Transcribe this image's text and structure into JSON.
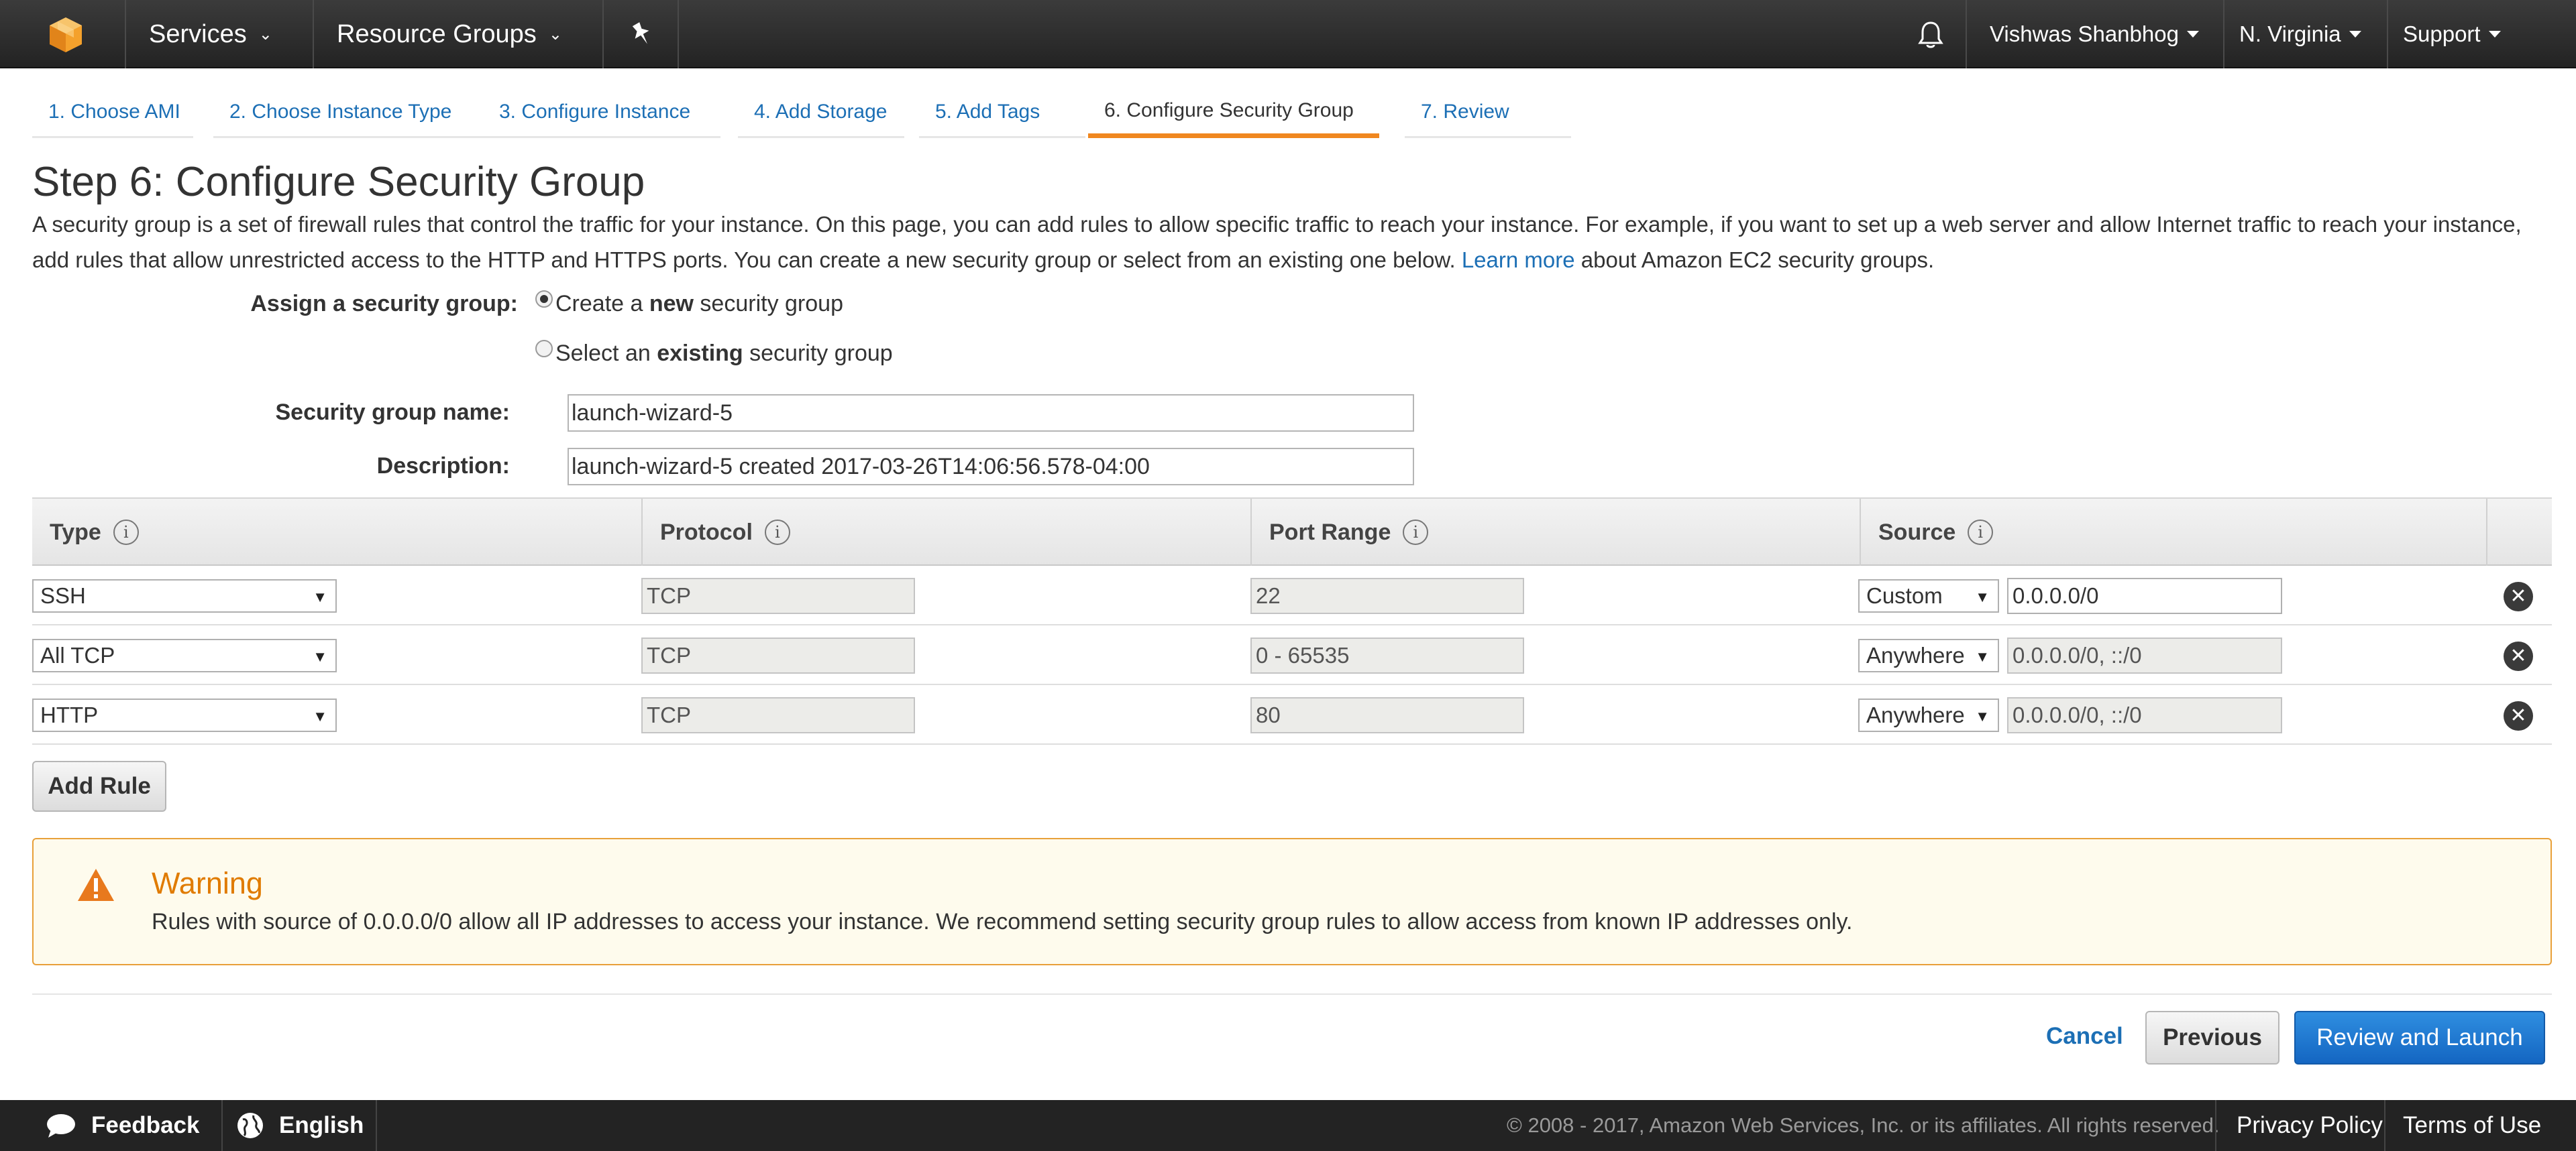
{
  "topnav": {
    "services_label": "Services",
    "resource_groups_label": "Resource Groups",
    "user_label": "Vishwas Shanbhog",
    "region_label": "N. Virginia",
    "support_label": "Support",
    "icons": [
      "aws-logo-icon",
      "pin-icon",
      "bell-icon"
    ]
  },
  "wizard_tabs": [
    {
      "label": "1. Choose AMI",
      "active": false
    },
    {
      "label": "2. Choose Instance Type",
      "active": false
    },
    {
      "label": "3. Configure Instance",
      "active": false
    },
    {
      "label": "4. Add Storage",
      "active": false
    },
    {
      "label": "5. Add Tags",
      "active": false
    },
    {
      "label": "6. Configure Security Group",
      "active": true
    },
    {
      "label": "7. Review",
      "active": false
    }
  ],
  "page": {
    "title": "Step 6: Configure Security Group",
    "intro_text": "A security group is a set of firewall rules that control the traffic for your instance. On this page, you can add rules to allow specific traffic to reach your instance. For example, if you want to set up a web server and allow Internet traffic to reach your instance, add rules that allow unrestricted access to the HTTP and HTTPS ports. You can create a new security group or select from an existing one below.",
    "learn_more_label": "Learn more",
    "intro_suffix": "about Amazon EC2 security groups."
  },
  "form": {
    "assign_label": "Assign a security group:",
    "option_new_prefix": "Create a ",
    "option_new_bold": "new",
    "option_new_suffix": " security group",
    "option_existing_prefix": "Select an ",
    "option_existing_bold": "existing",
    "option_existing_suffix": " security group",
    "selected_option": "new",
    "name_label": "Security group name:",
    "name_value": "launch-wizard-5",
    "description_label": "Description:",
    "description_value": "launch-wizard-5 created 2017-03-26T14:06:56.578-04:00"
  },
  "rules_table": {
    "columns": [
      "Type",
      "Protocol",
      "Port Range",
      "Source"
    ],
    "rows": [
      {
        "type": "SSH",
        "protocol": "TCP",
        "port_range": "22",
        "source_type": "Custom",
        "source_value": "0.0.0.0/0",
        "source_editable": true
      },
      {
        "type": "All TCP",
        "protocol": "TCP",
        "port_range": "0 - 65535",
        "source_type": "Anywhere",
        "source_value": "0.0.0.0/0, ::/0",
        "source_editable": false
      },
      {
        "type": "HTTP",
        "protocol": "TCP",
        "port_range": "80",
        "source_type": "Anywhere",
        "source_value": "0.0.0.0/0, ::/0",
        "source_editable": false
      }
    ],
    "add_rule_label": "Add Rule"
  },
  "warning": {
    "title": "Warning",
    "message": "Rules with source of 0.0.0.0/0 allow all IP addresses to access your instance. We recommend setting security group rules to allow access from known IP addresses only."
  },
  "actions": {
    "cancel_label": "Cancel",
    "previous_label": "Previous",
    "review_launch_label": "Review and Launch"
  },
  "footer": {
    "feedback_label": "Feedback",
    "language_label": "English",
    "copyright": "© 2008 - 2017, Amazon Web Services, Inc. or its affiliates. All rights reserved.",
    "privacy_label": "Privacy Policy",
    "terms_label": "Terms of Use"
  },
  "colors": {
    "accent_orange": "#f0871f",
    "link_blue": "#1c6fb5",
    "primary_button": "#1466c2",
    "warning_border": "#e8a03a",
    "warning_bg": "#fefbed",
    "nav_bg": "#2e2e2e"
  }
}
